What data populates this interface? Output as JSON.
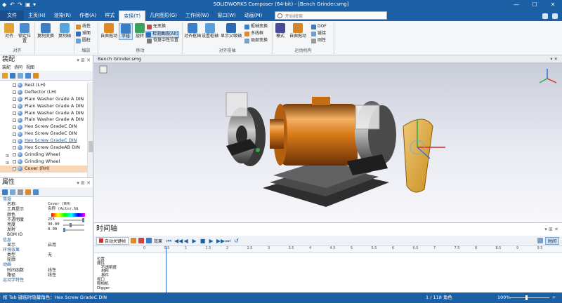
{
  "window": {
    "title": "SOLIDWORKS Composer (64-bit) - [Bench Grinder.smg]",
    "controls": [
      "—",
      "☐",
      "✕"
    ]
  },
  "ribbon_tabs": [
    "文件",
    "主页(H)",
    "渲染(R)",
    "作者(A)",
    "样式",
    "变换(T)",
    "几何图形(G)",
    "工作间(W)",
    "窗口(W)",
    "动画(M)"
  ],
  "active_tab": "变换(T)",
  "search_placeholder": "开始搜索",
  "ribbon": {
    "align": {
      "label": "对齐",
      "buttons": [
        "对齐",
        "锁定位置"
      ]
    },
    "copy": {
      "buttons": [
        "复制变换",
        "复制轴"
      ]
    },
    "transform_small": [
      "线性",
      "球面",
      "圆柱"
    ],
    "scale_label": "缩放",
    "move": {
      "label": "移动",
      "buttons": [
        "自由拖动",
        "平移",
        "旋转"
      ],
      "small": [
        "无变换",
        "检测曲线(Alt)",
        "恢复中性位置"
      ]
    },
    "axis": {
      "label": "对齐枢轴",
      "buttons": [
        "对齐枢轴",
        "设置枢轴",
        "显示父级轴"
      ],
      "small": [
        "枢轴变换",
        "多线框",
        "局部变换"
      ]
    },
    "kinematics": {
      "label": "运动机构",
      "buttons": [
        "模式",
        "自由拖动"
      ],
      "small": [
        "DOF",
        "链接",
        "刚性"
      ]
    }
  },
  "assembly": {
    "title": "装配",
    "subtabs": [
      "装配",
      "协同",
      "视图"
    ],
    "tree": [
      {
        "label": "Rest (LH)",
        "style": "normal"
      },
      {
        "label": "Deflector (LH)",
        "style": "normal"
      },
      {
        "label": "Plain Washer Grade A DIN",
        "style": "normal"
      },
      {
        "label": "Plain Washer Grade A DIN",
        "style": "normal"
      },
      {
        "label": "Plain Washer Grade A DIN",
        "style": "normal"
      },
      {
        "label": "Plain Washer Grade A DIN",
        "style": "normal"
      },
      {
        "label": "Hex Screw GradeC DIN",
        "style": "normal"
      },
      {
        "label": "Hex Screw GradeC DIN",
        "style": "normal"
      },
      {
        "label": "Hex Screw GradeC DIN",
        "style": "link"
      },
      {
        "label": "Hex Screw GradeAB DIN",
        "style": "normal"
      },
      {
        "label": "Grinding Wheel",
        "style": "expand"
      },
      {
        "label": "Grinding Wheel",
        "style": "expand"
      },
      {
        "label": "Cover (RH)",
        "style": "selected"
      }
    ]
  },
  "properties": {
    "title": "属性",
    "rows": [
      {
        "name": "常规",
        "value": "",
        "cat": true
      },
      {
        "name": "名称",
        "value": "Cover (RH)",
        "mono": true
      },
      {
        "name": "工具提示",
        "value": "名称 (Actor.Ni",
        "mono": true
      },
      {
        "name": "颜色",
        "value": ""
      },
      {
        "name": "不透明度",
        "value": "255",
        "mono": true
      },
      {
        "name": "亮度",
        "value": "30.00",
        "mono": true
      },
      {
        "name": "发射",
        "value": "0.00",
        "mono": true
      },
      {
        "name": "BOM ID",
        "value": ""
      },
      {
        "name": "信息",
        "value": "",
        "cat": true
      },
      {
        "name": "显示",
        "value": "启用"
      },
      {
        "name": "环境效果",
        "value": "",
        "cat": true
      },
      {
        "name": "类型",
        "value": "无"
      },
      {
        "name": "轮廓",
        "value": ""
      },
      {
        "name": "动画",
        "value": "",
        "cat": true
      },
      {
        "name": "时间函数",
        "value": "线性"
      },
      {
        "name": "路径",
        "value": "线性"
      },
      {
        "name": "运动学特性",
        "value": "",
        "cat": true
      }
    ]
  },
  "viewport": {
    "tab": "Bench Grinder.smg"
  },
  "timeline": {
    "title": "时间轴",
    "auto_key": "自动关键帧",
    "effects": "效果",
    "time_btn": "时间",
    "ruler": [
      "0",
      "0.5",
      "1",
      "1.5",
      "2",
      "2.5",
      "3",
      "3.5",
      "4",
      "4.5",
      "5",
      "5.5",
      "6",
      "6.5",
      "7",
      "7.5",
      "8",
      "8.5",
      "9",
      "9.5"
    ],
    "tracks": [
      "位置",
      "属性",
      "不透明度",
      "材料",
      "事件",
      "视口",
      "照相机",
      "Digger"
    ]
  },
  "status": {
    "message": "按 Tab 键临时隐藏角色：Hex Screw GradeC DIN",
    "pages": "1 / 118 角色",
    "zoom": "100%"
  },
  "colors": {
    "accent": "#1b5fa5",
    "selection": "#f8d6b6",
    "motor": "#d87a18"
  }
}
